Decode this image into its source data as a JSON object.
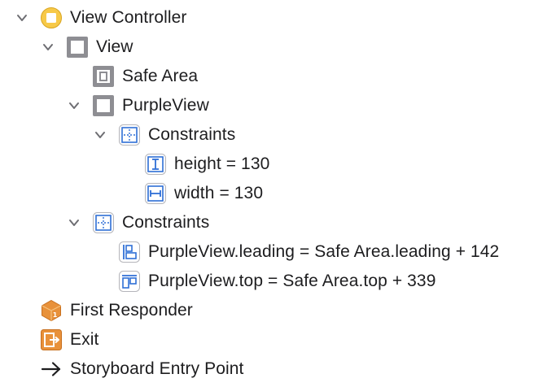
{
  "outline": {
    "view_controller": {
      "label": "View Controller",
      "expanded": true,
      "icon": "view-controller-icon"
    },
    "view": {
      "label": "View",
      "expanded": true,
      "icon": "view-icon"
    },
    "safe_area": {
      "label": "Safe Area",
      "icon": "safe-area-icon"
    },
    "purple_view": {
      "label": "PurpleView",
      "expanded": true,
      "icon": "view-icon"
    },
    "purple_constraints": {
      "label": "Constraints",
      "expanded": true,
      "icon": "constraints-icon"
    },
    "height_constraint": {
      "label": "height = 130",
      "icon": "height-constraint-icon"
    },
    "width_constraint": {
      "label": "width = 130",
      "icon": "width-constraint-icon"
    },
    "view_constraints": {
      "label": "Constraints",
      "expanded": true,
      "icon": "constraints-icon"
    },
    "leading_constraint": {
      "label": "PurpleView.leading = Safe Area.leading + 142",
      "icon": "leading-constraint-icon"
    },
    "top_constraint": {
      "label": "PurpleView.top = Safe Area.top + 339",
      "icon": "top-constraint-icon"
    },
    "first_responder": {
      "label": "First Responder",
      "icon": "first-responder-icon"
    },
    "exit": {
      "label": "Exit",
      "icon": "exit-icon"
    },
    "entry_point": {
      "label": "Storyboard Entry Point",
      "icon": "arrow-right-icon"
    }
  },
  "colors": {
    "text": "#1d1d1f",
    "chevron": "#6e6e73",
    "gray_icon": "#8e8e93",
    "blue_icon": "#2f6fd6",
    "yellow": "#f7c948",
    "orange": "#e8913a"
  }
}
